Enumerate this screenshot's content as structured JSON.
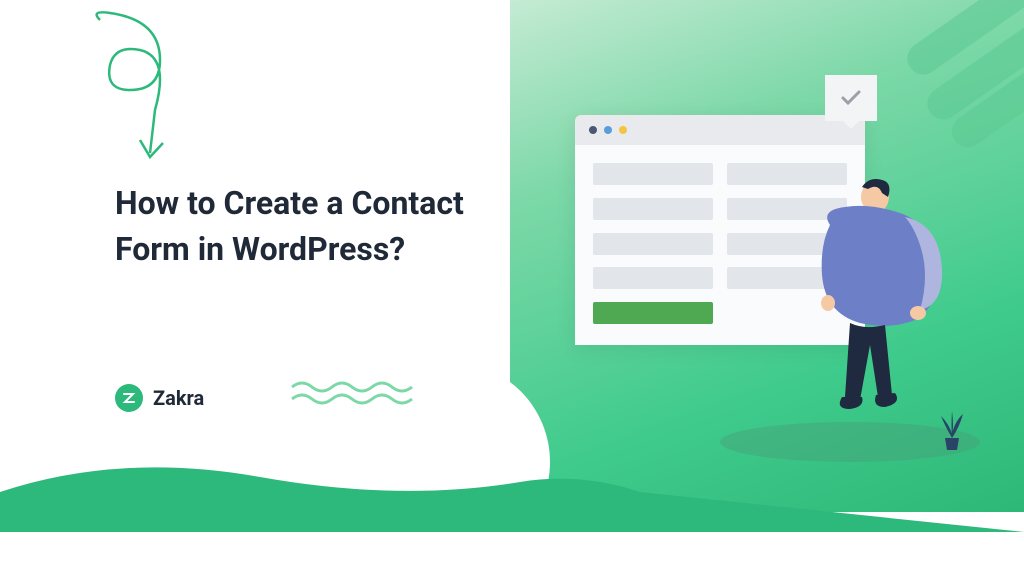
{
  "title": "How to Create a Contact Form in WordPress?",
  "brand": {
    "name": "Zakra"
  },
  "colors": {
    "accent_green": "#2db97b",
    "gradient_start": "#c8ecd6",
    "gradient_end": "#2eb878",
    "form_submit": "#4fa952"
  }
}
